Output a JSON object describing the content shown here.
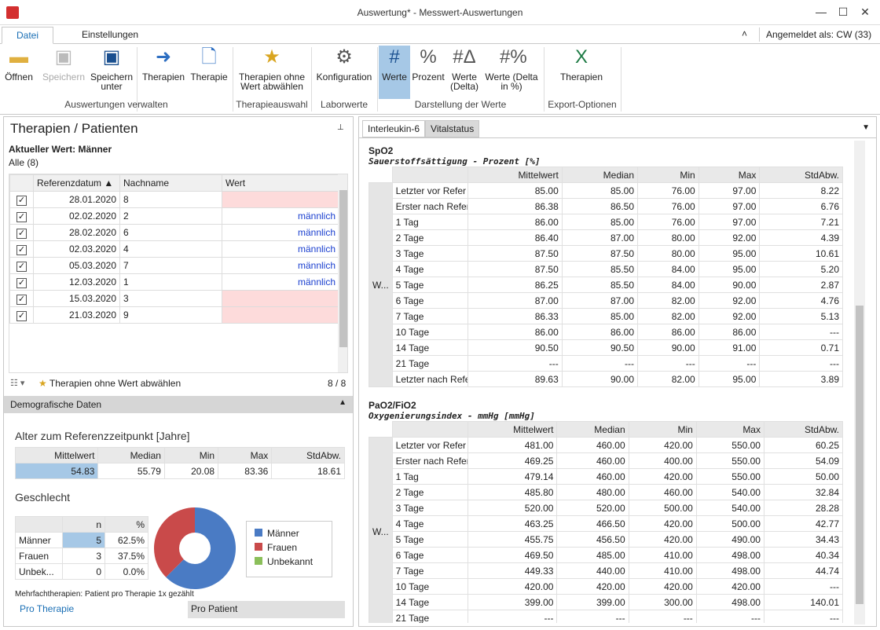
{
  "window": {
    "title": "Auswertung* - Messwert-Auswertungen"
  },
  "menu": {
    "tabs": [
      "Datei",
      "Einstellungen"
    ],
    "user_label": "Angemeldet als:",
    "user": "CW",
    "count": "(33)"
  },
  "ribbon": {
    "buttons": [
      {
        "label": "Öffnen",
        "icon": "folder-icon"
      },
      {
        "label": "Speichern",
        "icon": "save-icon",
        "disabled": true
      },
      {
        "label": "Speichern unter",
        "icon": "save-as-icon"
      },
      {
        "label": "Therapien",
        "icon": "arrow-icon"
      },
      {
        "label": "Therapie",
        "icon": "new-doc-icon"
      },
      {
        "label": "Therapien ohne Wert abwählen",
        "icon": "deselect-icon"
      },
      {
        "label": "Konfiguration",
        "icon": "config-icon"
      },
      {
        "label": "Werte",
        "icon": "hash-icon",
        "active": true
      },
      {
        "label": "Prozent",
        "icon": "percent-icon"
      },
      {
        "label": "Werte (Delta)",
        "icon": "hash-delta-icon"
      },
      {
        "label": "Werte (Delta in %)",
        "icon": "hash-percent-icon"
      },
      {
        "label": "Therapien",
        "icon": "excel-icon"
      }
    ],
    "groups": [
      "Auswertungen verwalten",
      "Therapieauswahl",
      "Laborwerte",
      "Darstellung der Werte",
      "Export-Optionen"
    ]
  },
  "left": {
    "title": "Therapien / Patienten",
    "current_label": "Aktueller Wert: Männer",
    "filter": "Alle (8)",
    "columns": [
      "Referenzdatum",
      "Nachname",
      "Wert"
    ],
    "rows": [
      {
        "date": "28.01.2020",
        "name": "8",
        "value": ""
      },
      {
        "date": "02.02.2020",
        "name": "2",
        "value": "männlich"
      },
      {
        "date": "28.02.2020",
        "name": "6",
        "value": "männlich"
      },
      {
        "date": "02.03.2020",
        "name": "4",
        "value": "männlich"
      },
      {
        "date": "05.03.2020",
        "name": "7",
        "value": "männlich"
      },
      {
        "date": "12.03.2020",
        "name": "1",
        "value": "männlich"
      },
      {
        "date": "15.03.2020",
        "name": "3",
        "value": ""
      },
      {
        "date": "21.03.2020",
        "name": "9",
        "value": ""
      }
    ],
    "footer_action": "Therapien ohne Wert abwählen",
    "footer_count": "8 / 8",
    "demo_header": "Demografische Daten",
    "age_title": "Alter zum Referenzzeitpunkt [Jahre]",
    "age_cols": [
      "Mittelwert",
      "Median",
      "Min",
      "Max",
      "StdAbw."
    ],
    "age_vals": [
      "54.83",
      "55.79",
      "20.08",
      "83.36",
      "18.61"
    ],
    "gender_title": "Geschlecht",
    "gender_cols": [
      "n",
      "%"
    ],
    "gender_rows": [
      [
        "Männer",
        "5",
        "62.5%"
      ],
      [
        "Frauen",
        "3",
        "37.5%"
      ],
      [
        "Unbek...",
        "0",
        "0.0%"
      ]
    ],
    "legend": [
      "Männer",
      "Frauen",
      "Unbekannt"
    ],
    "note": "Mehrfachtherapien: Patient pro Therapie 1x gezählt",
    "bottom_tabs": [
      "Pro Therapie",
      "Pro Patient"
    ]
  },
  "chart_data": {
    "type": "pie",
    "categories": [
      "Männer",
      "Frauen",
      "Unbekannt"
    ],
    "values": [
      62.5,
      37.5,
      0.0
    ],
    "colors": [
      "#4a7bc4",
      "#c94a4a",
      "#8bbf5a"
    ]
  },
  "right": {
    "tabs": [
      "Interleukin-6",
      "Vitalstatus"
    ],
    "cols": [
      "Mittelwert",
      "Median",
      "Min",
      "Max",
      "StdAbw."
    ],
    "side": "W...",
    "sections": [
      {
        "title": "SpO2",
        "subtitle": "Sauerstoffsättigung - Prozent [%]",
        "rows": [
          [
            "Letzter vor Refer",
            "85.00",
            "85.00",
            "76.00",
            "97.00",
            "8.22"
          ],
          [
            "Erster nach Refer",
            "86.38",
            "86.50",
            "76.00",
            "97.00",
            "6.76"
          ],
          [
            "1 Tag",
            "86.00",
            "85.00",
            "76.00",
            "97.00",
            "7.21"
          ],
          [
            "2 Tage",
            "86.40",
            "87.00",
            "80.00",
            "92.00",
            "4.39"
          ],
          [
            "3 Tage",
            "87.50",
            "87.50",
            "80.00",
            "95.00",
            "10.61"
          ],
          [
            "4 Tage",
            "87.50",
            "85.50",
            "84.00",
            "95.00",
            "5.20"
          ],
          [
            "5 Tage",
            "86.25",
            "85.50",
            "84.00",
            "90.00",
            "2.87"
          ],
          [
            "6 Tage",
            "87.00",
            "87.00",
            "82.00",
            "92.00",
            "4.76"
          ],
          [
            "7 Tage",
            "86.33",
            "85.00",
            "82.00",
            "92.00",
            "5.13"
          ],
          [
            "10 Tage",
            "86.00",
            "86.00",
            "86.00",
            "86.00",
            "---"
          ],
          [
            "14 Tage",
            "90.50",
            "90.50",
            "90.00",
            "91.00",
            "0.71"
          ],
          [
            "21 Tage",
            "---",
            "---",
            "---",
            "---",
            "---"
          ],
          [
            "Letzter nach Refe",
            "89.63",
            "90.00",
            "82.00",
            "95.00",
            "3.89"
          ]
        ]
      },
      {
        "title": "PaO2/FiO2",
        "subtitle": "Oxygenierungsindex - mmHg [mmHg]",
        "rows": [
          [
            "Letzter vor Refer",
            "481.00",
            "460.00",
            "420.00",
            "550.00",
            "60.25"
          ],
          [
            "Erster nach Refer",
            "469.25",
            "460.00",
            "400.00",
            "550.00",
            "54.09"
          ],
          [
            "1 Tag",
            "479.14",
            "460.00",
            "420.00",
            "550.00",
            "50.00"
          ],
          [
            "2 Tage",
            "485.80",
            "480.00",
            "460.00",
            "540.00",
            "32.84"
          ],
          [
            "3 Tage",
            "520.00",
            "520.00",
            "500.00",
            "540.00",
            "28.28"
          ],
          [
            "4 Tage",
            "463.25",
            "466.50",
            "420.00",
            "500.00",
            "42.77"
          ],
          [
            "5 Tage",
            "455.75",
            "456.50",
            "420.00",
            "490.00",
            "34.43"
          ],
          [
            "6 Tage",
            "469.50",
            "485.00",
            "410.00",
            "498.00",
            "40.34"
          ],
          [
            "7 Tage",
            "449.33",
            "440.00",
            "410.00",
            "498.00",
            "44.74"
          ],
          [
            "10 Tage",
            "420.00",
            "420.00",
            "420.00",
            "420.00",
            "---"
          ],
          [
            "14 Tage",
            "399.00",
            "399.00",
            "300.00",
            "498.00",
            "140.01"
          ],
          [
            "21 Tage",
            "---",
            "---",
            "---",
            "---",
            "---"
          ]
        ]
      }
    ]
  }
}
